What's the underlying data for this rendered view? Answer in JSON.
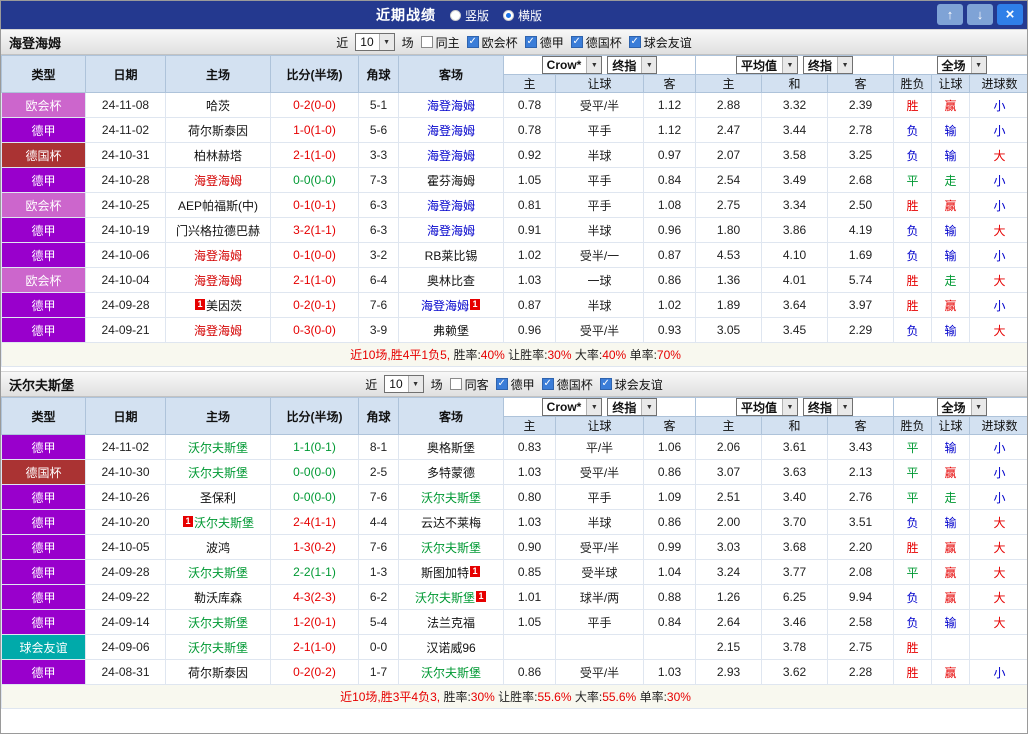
{
  "glyphs": {
    "dropdown": "▼",
    "check": "✓",
    "up": "↑",
    "down": "↓",
    "close": "×"
  },
  "colors": {
    "titlebar_bg": "#24398f",
    "close_button": "#2f7fe8",
    "nav_button": "#7fa3d6",
    "win_red": "#e60000",
    "draw_green": "#009933",
    "lose_blue": "#0000cc",
    "focal_blue": "#0000cc",
    "focal_red": "#d40000",
    "focal_green": "#009933",
    "league_europa": "#cc66cc",
    "league_bundesliga": "#9900cc",
    "league_cup": "#aa3333",
    "league_friendly": "#00aaaa",
    "header_bg": "#d3e1f1",
    "checkbox_blue": "#3b7dd8"
  },
  "titlebar": {
    "title": "近期战绩",
    "layout_options": [
      {
        "label": "竖版",
        "selected": false
      },
      {
        "label": "横版",
        "selected": true
      }
    ]
  },
  "columns": {
    "main": [
      "类型",
      "日期",
      "主场",
      "比分(半场)",
      "角球",
      "客场"
    ],
    "sub": [
      "主",
      "让球",
      "客",
      "主",
      "和",
      "客",
      "胜负",
      "让球",
      "进球数"
    ]
  },
  "controls": {
    "recent_label": "近",
    "recent_count": "10",
    "matches_label": "场",
    "odds_source": "Crow*",
    "stage": "终指",
    "eu_source": "平均值",
    "scope": "全场"
  },
  "sections": [
    {
      "team": "海登海姆",
      "same_filter": {
        "label": "同主",
        "checked": false
      },
      "leagues": [
        {
          "label": "欧会杯",
          "checked": true
        },
        {
          "label": "德甲",
          "checked": true
        },
        {
          "label": "德国杯",
          "checked": true
        },
        {
          "label": "球会友谊",
          "checked": true
        }
      ],
      "rows": [
        {
          "league": "欧会杯",
          "league_key": "europa",
          "date": "24-11-08",
          "home": {
            "name": "哈茨"
          },
          "score": "0-2(0-0)",
          "is_draw": false,
          "corners": "5-1",
          "away": {
            "name": "海登海姆",
            "focal": "blue"
          },
          "handicap_odds": [
            "0.78",
            "受平/半",
            "1.12"
          ],
          "europe_odds": [
            "2.88",
            "3.32",
            "2.39"
          ],
          "results": [
            "胜",
            "赢",
            "小"
          ]
        },
        {
          "league": "德甲",
          "league_key": "bundesliga",
          "date": "24-11-02",
          "home": {
            "name": "荷尔斯泰因"
          },
          "score": "1-0(1-0)",
          "is_draw": false,
          "corners": "5-6",
          "away": {
            "name": "海登海姆",
            "focal": "blue"
          },
          "handicap_odds": [
            "0.78",
            "平手",
            "1.12"
          ],
          "europe_odds": [
            "2.47",
            "3.44",
            "2.78"
          ],
          "results": [
            "负",
            "输",
            "小"
          ]
        },
        {
          "league": "德国杯",
          "league_key": "cup",
          "date": "24-10-31",
          "home": {
            "name": "柏林赫塔"
          },
          "score": "2-1(1-0)",
          "is_draw": false,
          "corners": "3-3",
          "away": {
            "name": "海登海姆",
            "focal": "blue"
          },
          "handicap_odds": [
            "0.92",
            "半球",
            "0.97"
          ],
          "europe_odds": [
            "2.07",
            "3.58",
            "3.25"
          ],
          "results": [
            "负",
            "输",
            "大"
          ]
        },
        {
          "league": "德甲",
          "league_key": "bundesliga",
          "date": "24-10-28",
          "home": {
            "name": "海登海姆",
            "focal": "red"
          },
          "score": "0-0(0-0)",
          "is_draw": true,
          "corners": "7-3",
          "away": {
            "name": "霍芬海姆"
          },
          "handicap_odds": [
            "1.05",
            "平手",
            "0.84"
          ],
          "europe_odds": [
            "2.54",
            "3.49",
            "2.68"
          ],
          "results": [
            "平",
            "走",
            "小"
          ]
        },
        {
          "league": "欧会杯",
          "league_key": "europa",
          "date": "24-10-25",
          "home": {
            "name": "AEP帕福斯(中)"
          },
          "score": "0-1(0-1)",
          "is_draw": false,
          "corners": "6-3",
          "away": {
            "name": "海登海姆",
            "focal": "blue"
          },
          "handicap_odds": [
            "0.81",
            "平手",
            "1.08"
          ],
          "europe_odds": [
            "2.75",
            "3.34",
            "2.50"
          ],
          "results": [
            "胜",
            "赢",
            "小"
          ]
        },
        {
          "league": "德甲",
          "league_key": "bundesliga",
          "date": "24-10-19",
          "home": {
            "name": "门兴格拉德巴赫"
          },
          "score": "3-2(1-1)",
          "is_draw": false,
          "corners": "6-3",
          "away": {
            "name": "海登海姆",
            "focal": "blue"
          },
          "handicap_odds": [
            "0.91",
            "半球",
            "0.96"
          ],
          "europe_odds": [
            "1.80",
            "3.86",
            "4.19"
          ],
          "results": [
            "负",
            "输",
            "大"
          ]
        },
        {
          "league": "德甲",
          "league_key": "bundesliga",
          "date": "24-10-06",
          "home": {
            "name": "海登海姆",
            "focal": "red"
          },
          "score": "0-1(0-0)",
          "is_draw": false,
          "corners": "3-2",
          "away": {
            "name": "RB莱比锡"
          },
          "handicap_odds": [
            "1.02",
            "受半/一",
            "0.87"
          ],
          "europe_odds": [
            "4.53",
            "4.10",
            "1.69"
          ],
          "results": [
            "负",
            "输",
            "小"
          ]
        },
        {
          "league": "欧会杯",
          "league_key": "europa",
          "date": "24-10-04",
          "home": {
            "name": "海登海姆",
            "focal": "red"
          },
          "score": "2-1(1-0)",
          "is_draw": false,
          "corners": "6-4",
          "away": {
            "name": "奥林比查"
          },
          "handicap_odds": [
            "1.03",
            "一球",
            "0.86"
          ],
          "europe_odds": [
            "1.36",
            "4.01",
            "5.74"
          ],
          "results": [
            "胜",
            "走",
            "大"
          ]
        },
        {
          "league": "德甲",
          "league_key": "bundesliga",
          "date": "24-09-28",
          "home": {
            "name": "美因茨",
            "card": "1",
            "card_pos": "pre"
          },
          "score": "0-2(0-1)",
          "is_draw": false,
          "corners": "7-6",
          "away": {
            "name": "海登海姆",
            "focal": "blue",
            "card": "1",
            "card_pos": "post"
          },
          "handicap_odds": [
            "0.87",
            "半球",
            "1.02"
          ],
          "europe_odds": [
            "1.89",
            "3.64",
            "3.97"
          ],
          "results": [
            "胜",
            "赢",
            "小"
          ]
        },
        {
          "league": "德甲",
          "league_key": "bundesliga",
          "date": "24-09-21",
          "home": {
            "name": "海登海姆",
            "focal": "red"
          },
          "score": "0-3(0-0)",
          "is_draw": false,
          "corners": "3-9",
          "away": {
            "name": "弗赖堡"
          },
          "handicap_odds": [
            "0.96",
            "受平/半",
            "0.93"
          ],
          "europe_odds": [
            "3.05",
            "3.45",
            "2.29"
          ],
          "results": [
            "负",
            "输",
            "大"
          ]
        }
      ],
      "summary": [
        {
          "text": "近10场,胜4平1负5,",
          "red": true
        },
        {
          "text": " 胜率:",
          "red": false
        },
        {
          "text": "40%",
          "red": true
        },
        {
          "text": " 让胜率:",
          "red": false
        },
        {
          "text": "30%",
          "red": true
        },
        {
          "text": " 大率:",
          "red": false
        },
        {
          "text": "40%",
          "red": true
        },
        {
          "text": " 单率:",
          "red": false
        },
        {
          "text": "70%",
          "red": true
        }
      ]
    },
    {
      "team": "沃尔夫斯堡",
      "same_filter": {
        "label": "同客",
        "checked": false
      },
      "leagues": [
        {
          "label": "德甲",
          "checked": true
        },
        {
          "label": "德国杯",
          "checked": true
        },
        {
          "label": "球会友谊",
          "checked": true
        }
      ],
      "rows": [
        {
          "league": "德甲",
          "league_key": "bundesliga",
          "date": "24-11-02",
          "home": {
            "name": "沃尔夫斯堡",
            "focal": "green"
          },
          "score": "1-1(0-1)",
          "is_draw": true,
          "corners": "8-1",
          "away": {
            "name": "奥格斯堡"
          },
          "handicap_odds": [
            "0.83",
            "平/半",
            "1.06"
          ],
          "europe_odds": [
            "2.06",
            "3.61",
            "3.43"
          ],
          "results": [
            "平",
            "输",
            "小"
          ]
        },
        {
          "league": "德国杯",
          "league_key": "cup",
          "date": "24-10-30",
          "home": {
            "name": "沃尔夫斯堡",
            "focal": "green"
          },
          "score": "0-0(0-0)",
          "is_draw": true,
          "corners": "2-5",
          "away": {
            "name": "多特蒙德"
          },
          "handicap_odds": [
            "1.03",
            "受平/半",
            "0.86"
          ],
          "europe_odds": [
            "3.07",
            "3.63",
            "2.13"
          ],
          "results": [
            "平",
            "赢",
            "小"
          ]
        },
        {
          "league": "德甲",
          "league_key": "bundesliga",
          "date": "24-10-26",
          "home": {
            "name": "圣保利"
          },
          "score": "0-0(0-0)",
          "is_draw": true,
          "corners": "7-6",
          "away": {
            "name": "沃尔夫斯堡",
            "focal": "green"
          },
          "handicap_odds": [
            "0.80",
            "平手",
            "1.09"
          ],
          "europe_odds": [
            "2.51",
            "3.40",
            "2.76"
          ],
          "results": [
            "平",
            "走",
            "小"
          ]
        },
        {
          "league": "德甲",
          "league_key": "bundesliga",
          "date": "24-10-20",
          "home": {
            "name": "沃尔夫斯堡",
            "focal": "green",
            "card": "1",
            "card_pos": "pre"
          },
          "score": "2-4(1-1)",
          "is_draw": false,
          "corners": "4-4",
          "away": {
            "name": "云达不莱梅"
          },
          "handicap_odds": [
            "1.03",
            "半球",
            "0.86"
          ],
          "europe_odds": [
            "2.00",
            "3.70",
            "3.51"
          ],
          "results": [
            "负",
            "输",
            "大"
          ]
        },
        {
          "league": "德甲",
          "league_key": "bundesliga",
          "date": "24-10-05",
          "home": {
            "name": "波鸿"
          },
          "score": "1-3(0-2)",
          "is_draw": false,
          "corners": "7-6",
          "away": {
            "name": "沃尔夫斯堡",
            "focal": "green"
          },
          "handicap_odds": [
            "0.90",
            "受平/半",
            "0.99"
          ],
          "europe_odds": [
            "3.03",
            "3.68",
            "2.20"
          ],
          "results": [
            "胜",
            "赢",
            "大"
          ]
        },
        {
          "league": "德甲",
          "league_key": "bundesliga",
          "date": "24-09-28",
          "home": {
            "name": "沃尔夫斯堡",
            "focal": "green"
          },
          "score": "2-2(1-1)",
          "is_draw": true,
          "corners": "1-3",
          "away": {
            "name": "斯图加特",
            "card": "1",
            "card_pos": "post"
          },
          "handicap_odds": [
            "0.85",
            "受半球",
            "1.04"
          ],
          "europe_odds": [
            "3.24",
            "3.77",
            "2.08"
          ],
          "results": [
            "平",
            "赢",
            "大"
          ]
        },
        {
          "league": "德甲",
          "league_key": "bundesliga",
          "date": "24-09-22",
          "home": {
            "name": "勒沃库森"
          },
          "score": "4-3(2-3)",
          "is_draw": false,
          "corners": "6-2",
          "away": {
            "name": "沃尔夫斯堡",
            "focal": "green",
            "card": "1",
            "card_pos": "post"
          },
          "handicap_odds": [
            "1.01",
            "球半/两",
            "0.88"
          ],
          "europe_odds": [
            "1.26",
            "6.25",
            "9.94"
          ],
          "results": [
            "负",
            "赢",
            "大"
          ]
        },
        {
          "league": "德甲",
          "league_key": "bundesliga",
          "date": "24-09-14",
          "home": {
            "name": "沃尔夫斯堡",
            "focal": "green"
          },
          "score": "1-2(0-1)",
          "is_draw": false,
          "corners": "5-4",
          "away": {
            "name": "法兰克福"
          },
          "handicap_odds": [
            "1.05",
            "平手",
            "0.84"
          ],
          "europe_odds": [
            "2.64",
            "3.46",
            "2.58"
          ],
          "results": [
            "负",
            "输",
            "大"
          ]
        },
        {
          "league": "球会友谊",
          "league_key": "friendly",
          "date": "24-09-06",
          "home": {
            "name": "沃尔夫斯堡",
            "focal": "green"
          },
          "score": "2-1(1-0)",
          "is_draw": false,
          "corners": "0-0",
          "away": {
            "name": "汉诺威96"
          },
          "handicap_odds": [
            "",
            "",
            ""
          ],
          "europe_odds": [
            "2.15",
            "3.78",
            "2.75"
          ],
          "results": [
            "胜",
            "",
            ""
          ]
        },
        {
          "league": "德甲",
          "league_key": "bundesliga",
          "date": "24-08-31",
          "home": {
            "name": "荷尔斯泰因"
          },
          "score": "0-2(0-2)",
          "is_draw": false,
          "corners": "1-7",
          "away": {
            "name": "沃尔夫斯堡",
            "focal": "green"
          },
          "handicap_odds": [
            "0.86",
            "受平/半",
            "1.03"
          ],
          "europe_odds": [
            "2.93",
            "3.62",
            "2.28"
          ],
          "results": [
            "胜",
            "赢",
            "小"
          ]
        }
      ],
      "summary": [
        {
          "text": "近10场,胜3平4负3,",
          "red": true
        },
        {
          "text": " 胜率:",
          "red": false
        },
        {
          "text": "30%",
          "red": true
        },
        {
          "text": " 让胜率:",
          "red": false
        },
        {
          "text": "55.6%",
          "red": true
        },
        {
          "text": " 大率:",
          "red": false
        },
        {
          "text": "55.6%",
          "red": true
        },
        {
          "text": " 单率:",
          "red": false
        },
        {
          "text": "30%",
          "red": true
        }
      ]
    }
  ]
}
